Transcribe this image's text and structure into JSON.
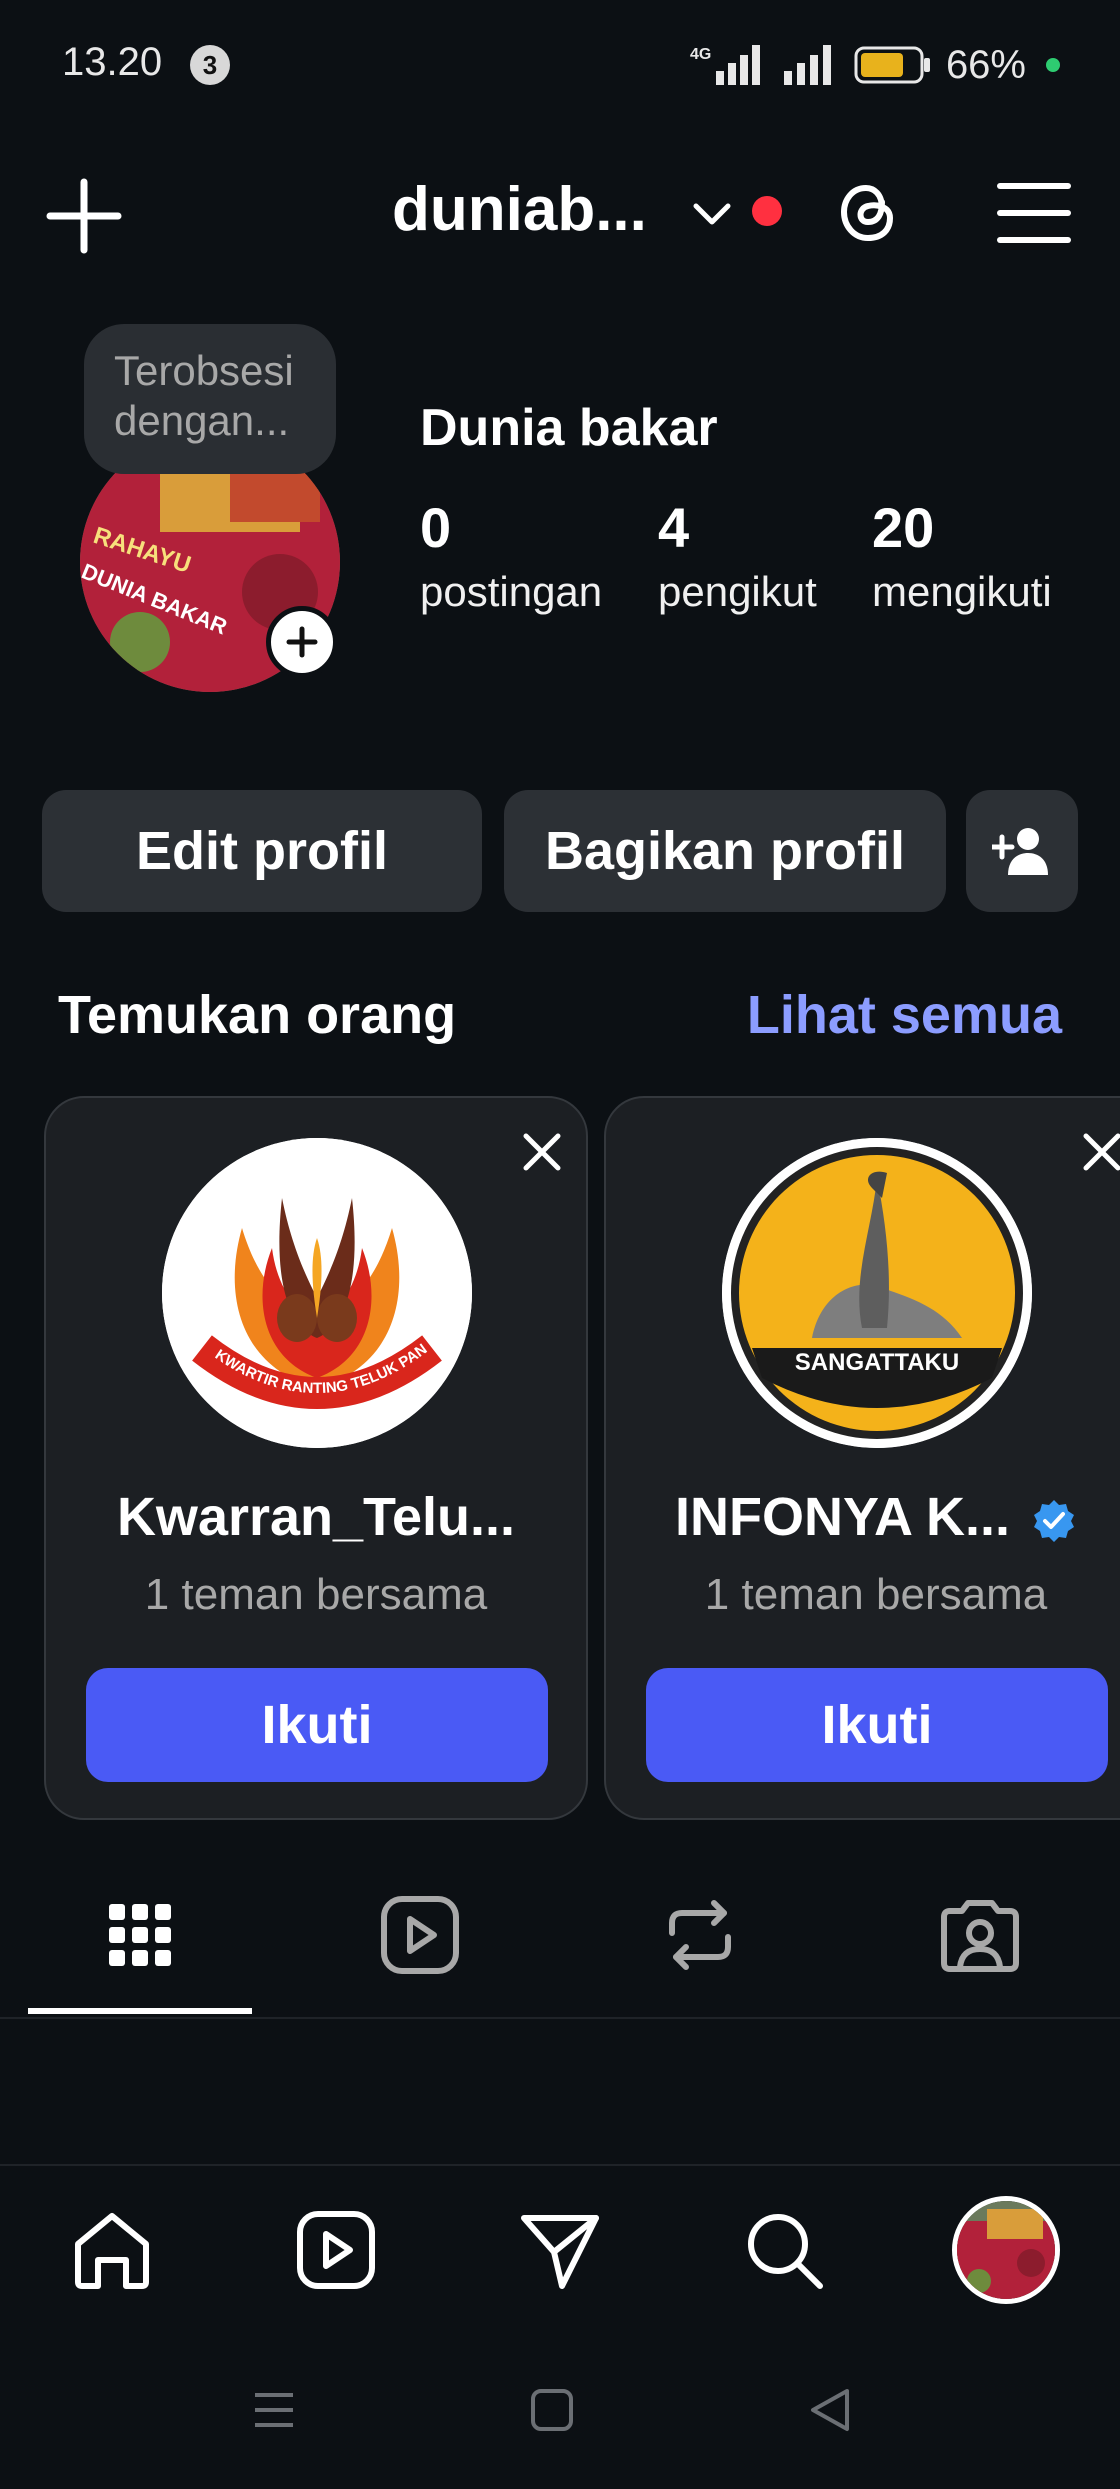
{
  "status_bar": {
    "time": "13.20",
    "notification_count": "3",
    "network": "4G",
    "battery": "66%"
  },
  "top_nav": {
    "username": "duniab...",
    "icons": [
      "plus-icon",
      "chevron-down-icon",
      "threads-icon",
      "menu-icon"
    ]
  },
  "profile": {
    "note": "Terobsesi dengan...",
    "name": "Dunia bakar",
    "stats": [
      {
        "value": "0",
        "label": "postingan"
      },
      {
        "value": "4",
        "label": "pengikut"
      },
      {
        "value": "20",
        "label": "mengikuti"
      }
    ],
    "avatar_text": [
      "RAHAYU",
      "DUNIA BAKAR"
    ]
  },
  "actions": {
    "edit": "Edit profil",
    "share": "Bagikan profil"
  },
  "discover": {
    "title": "Temukan orang",
    "see_all": "Lihat semua",
    "cards": [
      {
        "name": "Kwarran_Telu...",
        "mutual": "1 teman bersama",
        "follow": "Ikuti",
        "verified": false,
        "logo_text": "KWARTIR RANTING TELUK PANDAN"
      },
      {
        "name": "INFONYA K...",
        "mutual": "1 teman bersama",
        "follow": "Ikuti",
        "verified": true,
        "logo_text": "SANGATTAKU"
      }
    ]
  },
  "tabs": [
    "grid-icon",
    "reels-icon",
    "repost-icon",
    "tagged-icon"
  ],
  "bottom_nav": [
    "home-icon",
    "reels-icon",
    "send-icon",
    "search-icon",
    "profile-avatar"
  ],
  "colors": {
    "background": "#0c1014",
    "button": "#2c3035",
    "accent": "#4a5af5",
    "link": "#8c9dff",
    "notification": "#ff3040"
  }
}
